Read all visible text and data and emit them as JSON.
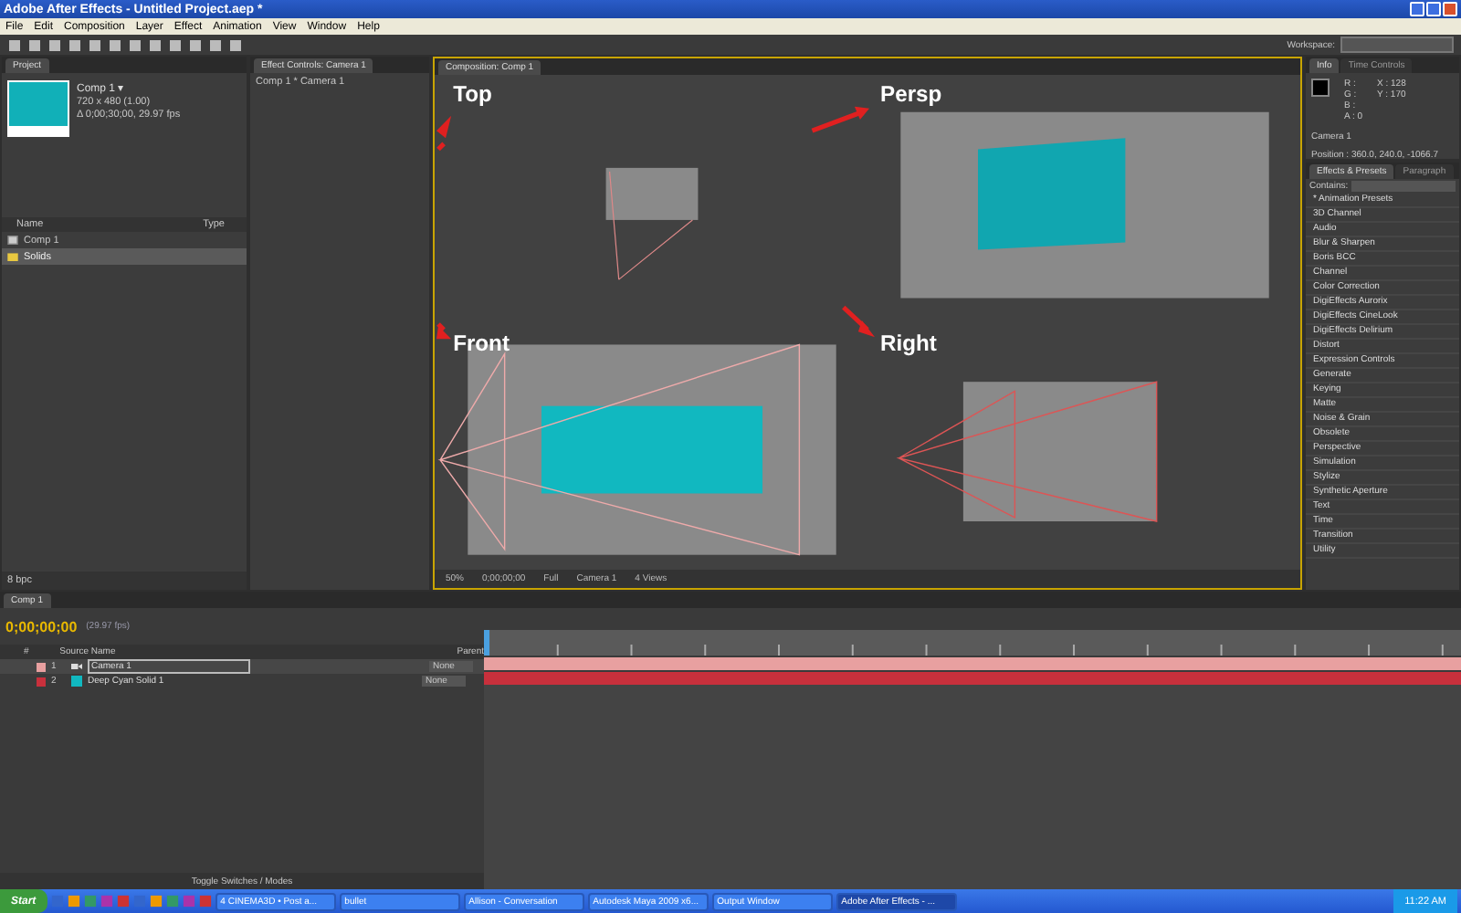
{
  "window": {
    "title": "Adobe After Effects - Untitled Project.aep *"
  },
  "menu": [
    "File",
    "Edit",
    "Composition",
    "Layer",
    "Effect",
    "Animation",
    "View",
    "Window",
    "Help"
  ],
  "workspace": {
    "label": "Workspace:"
  },
  "project": {
    "tab": "Project",
    "comp_name": "Comp 1 ▾",
    "comp_info": [
      "720 x 480 (1.00)",
      "Δ 0;00;30;00, 29.97 fps"
    ],
    "columns": [
      "Name",
      "Type"
    ],
    "items": [
      {
        "name": "Comp 1",
        "kind": "comp",
        "selected": false
      },
      {
        "name": "Solids",
        "kind": "folder",
        "selected": true
      }
    ],
    "bpc": "8 bpc"
  },
  "effect_controls": {
    "tab": "Effect Controls: Camera 1",
    "path": "Comp 1 * Camera 1"
  },
  "composition": {
    "tab": "Composition: Comp 1",
    "views": [
      {
        "label": "Top"
      },
      {
        "label": "Persp"
      },
      {
        "label": "Front"
      },
      {
        "label": "Right"
      }
    ],
    "toolbar": [
      "50%",
      "0;00;00;00",
      "Full",
      "Camera 1",
      "4 Views"
    ]
  },
  "info": {
    "tabs": [
      {
        "label": "Info",
        "selected": true
      },
      {
        "label": "Time Controls",
        "selected": false
      }
    ],
    "channels": [
      "R :",
      "G :",
      "B :",
      "A : 0"
    ],
    "coords": [
      "X : 128",
      "Y : 170"
    ],
    "layer": "Camera 1",
    "position": "Position : 360.0, 240.0, -1066.7"
  },
  "effects": {
    "tabs": [
      {
        "label": "Effects & Presets",
        "selected": true
      },
      {
        "label": "Paragraph",
        "selected": false
      }
    ],
    "search_label": "Contains:",
    "items": [
      "* Animation Presets",
      "3D Channel",
      "Audio",
      "Blur & Sharpen",
      "Boris BCC",
      "Channel",
      "Color Correction",
      "DigiEffects Aurorix",
      "DigiEffects CineLook",
      "DigiEffects Delirium",
      "Distort",
      "Expression Controls",
      "Generate",
      "Keying",
      "Matte",
      "Noise & Grain",
      "Obsolete",
      "Perspective",
      "Simulation",
      "Stylize",
      "Synthetic Aperture",
      "Text",
      "Time",
      "Transition",
      "Utility"
    ]
  },
  "timeline": {
    "tab": "Comp 1",
    "timecode": "0;00;00;00",
    "fps": "(29.97 fps)",
    "columns": [
      "#",
      "Source Name",
      "Parent"
    ],
    "layers": [
      {
        "num": "1",
        "name": "Camera 1",
        "kind": "camera",
        "selected": true,
        "parent": "None",
        "color": "#e8a0a0"
      },
      {
        "num": "2",
        "name": "Deep Cyan Solid 1",
        "kind": "solid",
        "selected": false,
        "parent": "None",
        "color": "#c8303c"
      }
    ],
    "footer": "Toggle Switches / Modes"
  },
  "taskbar": {
    "start": "Start",
    "tasks": [
      {
        "label": "4 CINEMA3D • Post a...",
        "selected": false
      },
      {
        "label": "bullet",
        "selected": false
      },
      {
        "label": "Allison - Conversation",
        "selected": false
      },
      {
        "label": "Autodesk Maya 2009 x6...",
        "selected": false
      },
      {
        "label": "Output Window",
        "selected": false
      },
      {
        "label": "Adobe After Effects - ...",
        "selected": true
      }
    ],
    "clock": "11:22 AM"
  }
}
